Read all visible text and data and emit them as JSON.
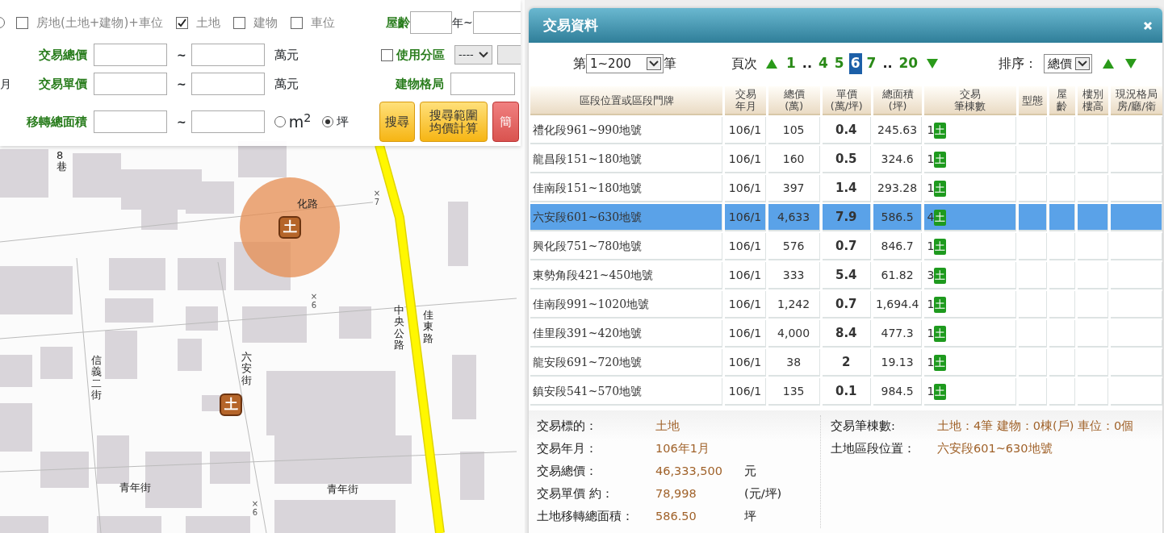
{
  "search_form": {
    "edge_radio": {
      "selected": false
    },
    "property_types": [
      {
        "label": "房地(土地+建物)+車位",
        "checked": false
      },
      {
        "label": "土地",
        "checked": true
      },
      {
        "label": "建物",
        "checked": false
      },
      {
        "label": "車位",
        "checked": false
      }
    ],
    "house_age": {
      "label": "屋齡",
      "separator": "年~"
    },
    "total_price": {
      "label": "交易總價",
      "separator": "~",
      "unit": "萬元"
    },
    "cut_label": "月",
    "unit_price": {
      "label": "交易單價",
      "separator": "~",
      "unit": "萬元"
    },
    "area": {
      "label": "移轉總面積",
      "separator": "~",
      "units": [
        {
          "label": "m$^{2}$",
          "selected": false
        },
        {
          "label": "坪",
          "selected": true
        }
      ]
    },
    "zoning": {
      "label": "使用分區",
      "checked": false,
      "value": "----"
    },
    "layout": {
      "label": "建物格局"
    },
    "buttons": [
      {
        "label": "搜尋",
        "kind": "search"
      },
      {
        "label": "搜尋範圍均價計算",
        "kind": "search"
      },
      {
        "label": "簡",
        "kind": "danger"
      }
    ]
  },
  "map": {
    "labels": [
      {
        "text": "8巷",
        "kind": "vertical"
      },
      {
        "text": "化路",
        "kind": "horizontal"
      },
      {
        "text": "×7",
        "kind": "spot"
      },
      {
        "text": "×6",
        "kind": "spot"
      },
      {
        "text": "信義二街",
        "kind": "vertical"
      },
      {
        "text": "六安街",
        "kind": "vertical"
      },
      {
        "text": "中央公路",
        "kind": "vertical"
      },
      {
        "text": "佳東路",
        "kind": "vertical"
      },
      {
        "text": "青年街",
        "kind": "horizontal"
      },
      {
        "text": "青年街",
        "kind": "horizontal"
      },
      {
        "text": "×6",
        "kind": "spot"
      }
    ],
    "markers": [
      {
        "label": "土",
        "highlighted": true
      },
      {
        "label": "土",
        "highlighted": false
      }
    ]
  },
  "panel": {
    "title": "交易資料",
    "range": {
      "prefix": "第",
      "value": "1~200",
      "suffix": "筆"
    },
    "pager": {
      "label": "頁次",
      "pages": [
        {
          "kind": "page",
          "label": "1",
          "selected": false
        },
        {
          "kind": "gap",
          "label": ".."
        },
        {
          "kind": "page",
          "label": "4",
          "selected": false
        },
        {
          "kind": "page",
          "label": "5",
          "selected": false
        },
        {
          "kind": "page",
          "label": "6",
          "selected": true
        },
        {
          "kind": "page",
          "label": "7",
          "selected": false
        },
        {
          "kind": "gap",
          "label": ".."
        },
        {
          "kind": "page",
          "label": "20",
          "selected": false
        }
      ]
    },
    "sort": {
      "label": "排序：",
      "value": "總價"
    },
    "table": {
      "columns": [
        [
          "區段位置或區段門牌"
        ],
        [
          "交易",
          "年月"
        ],
        [
          "總價",
          "(萬)"
        ],
        [
          "單價",
          "(萬/坪)"
        ],
        [
          "總面積",
          "(坪)"
        ],
        [
          "交易",
          "筆棟數"
        ],
        [
          "型態"
        ],
        [
          "屋",
          "齡"
        ],
        [
          "樓別",
          "樓高"
        ],
        [
          "現況格局",
          "房/廳/衛"
        ]
      ],
      "rows": [
        {
          "location": "禮化段961~990地號",
          "date": "106/1",
          "total": "105",
          "unit": "0.4",
          "area": "245.63",
          "count": "1",
          "badge": "土",
          "selected": false
        },
        {
          "location": "龍昌段151~180地號",
          "date": "106/1",
          "total": "160",
          "unit": "0.5",
          "area": "324.6",
          "count": "1",
          "badge": "土",
          "selected": false
        },
        {
          "location": "佳南段151~180地號",
          "date": "106/1",
          "total": "397",
          "unit": "1.4",
          "area": "293.28",
          "count": "1",
          "badge": "土",
          "selected": false
        },
        {
          "location": "六安段601~630地號",
          "date": "106/1",
          "total": "4,633",
          "unit": "7.9",
          "area": "586.5",
          "count": "4",
          "badge": "土",
          "selected": true
        },
        {
          "location": "興化段751~780地號",
          "date": "106/1",
          "total": "576",
          "unit": "0.7",
          "area": "846.7",
          "count": "1",
          "badge": "土",
          "selected": false
        },
        {
          "location": "東勢角段421~450地號",
          "date": "106/1",
          "total": "333",
          "unit": "5.4",
          "area": "61.82",
          "count": "3",
          "badge": "土",
          "selected": false
        },
        {
          "location": "佳南段991~1020地號",
          "date": "106/1",
          "total": "1,242",
          "unit": "0.7",
          "area": "1,694.4",
          "count": "1",
          "badge": "土",
          "selected": false
        },
        {
          "location": "佳里段391~420地號",
          "date": "106/1",
          "total": "4,000",
          "unit": "8.4",
          "area": "477.3",
          "count": "1",
          "badge": "土",
          "selected": false
        },
        {
          "location": "龍安段691~720地號",
          "date": "106/1",
          "total": "38",
          "unit": "2",
          "area": "19.13",
          "count": "1",
          "badge": "土",
          "selected": false
        },
        {
          "location": "鎮安段541~570地號",
          "date": "106/1",
          "total": "135",
          "unit": "0.1",
          "area": "984.5",
          "count": "1",
          "badge": "土",
          "selected": false
        }
      ]
    },
    "details": {
      "left": [
        {
          "label": "交易標的：",
          "value": "土地"
        },
        {
          "label": "交易年月：",
          "value": "106年1月"
        },
        {
          "label": "交易總價：",
          "value": "46,333,500",
          "unit": "元"
        },
        {
          "label": "交易單價 約：",
          "value": "78,998",
          "unit": "(元/坪)"
        },
        {
          "label": "土地移轉總面積：",
          "value": "586.50",
          "unit": "坪"
        }
      ],
      "right": [
        {
          "label": "交易筆棟數:",
          "value": "土地：4筆 建物：0棟(戶) 車位：0個"
        },
        {
          "label": "土地區段位置：",
          "value": "六安段601~630地號"
        }
      ]
    }
  }
}
